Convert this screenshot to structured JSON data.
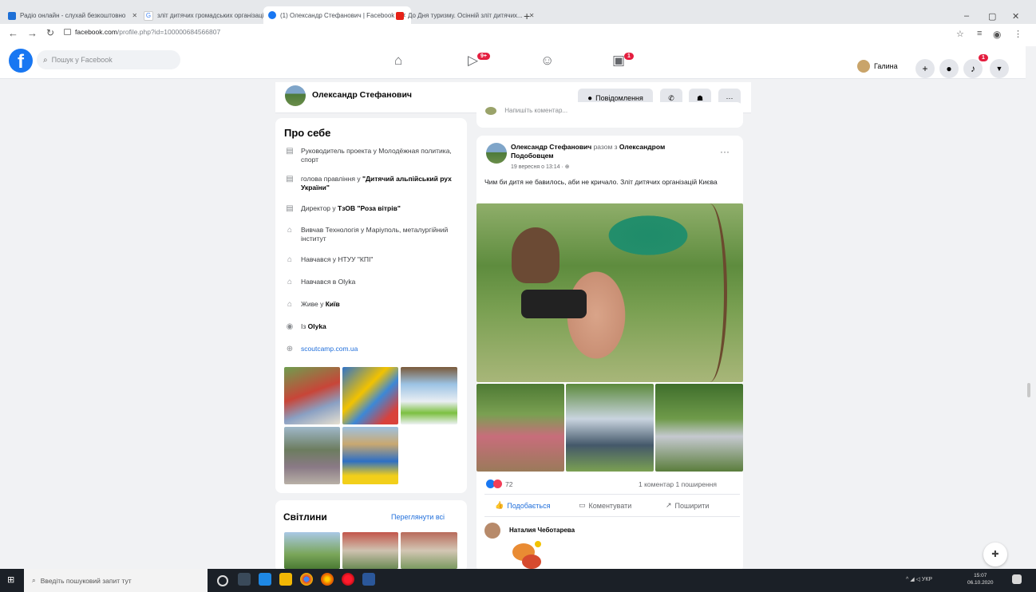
{
  "browser": {
    "tabs": [
      {
        "title": "Радіо онлайн - слухай безкоштовно"
      },
      {
        "title": "зліт дитячих громадських організацій"
      },
      {
        "title": "(1) Олександр Стефанович | Facebook"
      },
      {
        "title": "До Дня туризму. Осінній зліт дитячих..."
      }
    ],
    "url_host": "facebook.com",
    "url_path": "/profile.php?id=100000684566807",
    "minimize": "–",
    "maximize": "▢",
    "close": "✕"
  },
  "fb": {
    "search_placeholder": "Пошук у Facebook",
    "watch_badge": "9+",
    "gaming_badge": "1",
    "user_name": "Галина",
    "notif_badge": "1"
  },
  "profile": {
    "name": "Олександр Стефанович",
    "message_btn": "Повідомлення"
  },
  "about": {
    "title": "Про себе",
    "items": [
      {
        "text": "Руководитель проекта у Молодёжная политика, спорт"
      },
      {
        "pre": "голова правління у ",
        "bold": "\"Дитячий альпійський рух України\""
      },
      {
        "pre": "Директор у ",
        "bold": "ТзОВ \"Роза вітрів\""
      },
      {
        "text": "Вивчав Технологія у Маріуполь, металургійний інститут"
      },
      {
        "text": "Навчався у НТУУ \"КПІ\""
      },
      {
        "text": "Навчався в Olyka"
      },
      {
        "pre": "Живе у ",
        "bold": "Київ"
      },
      {
        "pre": "Із ",
        "bold": "Olyka"
      },
      {
        "link": "scoutcamp.com.ua"
      }
    ]
  },
  "photos": {
    "title": "Світлини",
    "see_all": "Переглянути всі"
  },
  "prev_post": {
    "comment_placeholder": "Напишіть коментар..."
  },
  "post": {
    "author": "Олександр Стефанович",
    "with_text": " разом з ",
    "with_name": "Олександром Подобовцем",
    "date": "19 вересня о 13:14 · ",
    "text": "Чим би дитя не бавилось, аби не кричало. Зліт дитячих організацій Києва",
    "reactions_count": "72",
    "stats": "1 коментар  1 поширення",
    "like": "Подобається",
    "comment": "Коментувати",
    "share": "Поширити",
    "commenter": "Наталия Чеботарева"
  },
  "taskbar": {
    "search_placeholder": "Введіть пошуковий запит тут",
    "lang": "УКР",
    "time": "15:07",
    "date": "06.10.2020"
  },
  "colors": {
    "fb_blue": "#1877f2",
    "badge_red": "#e41e3f",
    "link_blue": "#216fdb"
  }
}
